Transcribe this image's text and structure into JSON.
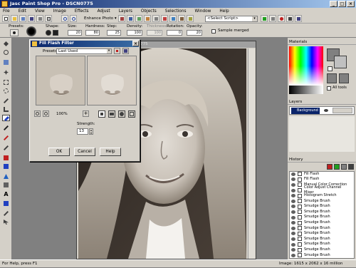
{
  "app": {
    "title": "Jasc Paint Shop Pro - DSCN0775"
  },
  "menu": [
    "File",
    "Edit",
    "View",
    "Image",
    "Effects",
    "Adjust",
    "Layers",
    "Objects",
    "Selections",
    "Window",
    "Help"
  ],
  "toolbar": {
    "enhance_photo": "Enhance Photo",
    "script_select": "<Select Script>"
  },
  "options": {
    "presets_label": "Presets:",
    "shape_label": "Shape:",
    "size_label": "Size:",
    "size_value": "20",
    "hardness_label": "Hardness:",
    "hardness_value": "80",
    "step_label": "Step:",
    "step_value": "25",
    "density_label": "Density:",
    "density_value": "100",
    "thickness_label": "Thickness:",
    "thickness_value": "100",
    "rotation_label": "Rotation:",
    "rotation_value": "0",
    "opacity_label": "Opacity:",
    "opacity_value": "20",
    "sample_merged": "Sample merged"
  },
  "image_window": {
    "title": "DSCN0775"
  },
  "dialog": {
    "title": "Fill Flash Filter",
    "presets_label": "Presets:",
    "presets_value": "Last Used",
    "zoom": "100%",
    "strength_label": "Strength:",
    "strength_value": "13",
    "ok": "OK",
    "cancel": "Cancel",
    "help": "Help"
  },
  "panels": {
    "materials": "Materials",
    "all_tools": "All tools",
    "layers": "Layers",
    "layer_name": "Background",
    "history": "History"
  },
  "history_items": [
    "Fill Flash",
    "Fill Flash",
    "Manual Color Correction",
    "Color Adjust Channel Mixer",
    "Histogram Stretch",
    "Smudge Brush",
    "Smudge Brush",
    "Smudge Brush",
    "Smudge Brush",
    "Smudge Brush",
    "Smudge Brush",
    "Smudge Brush",
    "Smudge Brush",
    "Smudge Brush",
    "Smudge Brush",
    "Smudge Brush"
  ],
  "status": {
    "left": "For Help, press F1",
    "right": "Image: 1615 x 2062 x 16 million"
  },
  "colors": {
    "titlebar": "#0a246a",
    "chrome": "#d4d0c8",
    "workspace": "#808080",
    "selected_layer": "#0a246a"
  }
}
